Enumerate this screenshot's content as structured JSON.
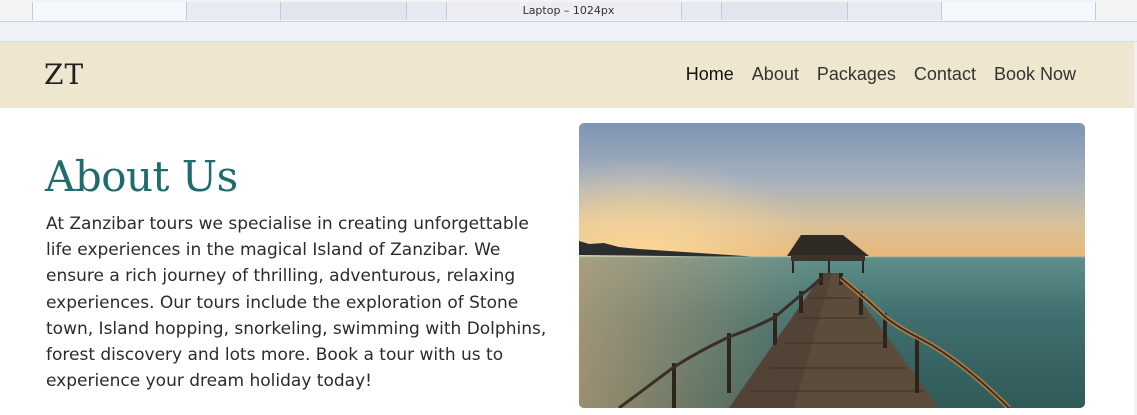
{
  "devtools": {
    "viewport_label": "Laptop – 1024px"
  },
  "header": {
    "logo": "ZT",
    "nav": [
      {
        "label": "Home",
        "active": true
      },
      {
        "label": "About",
        "active": false
      },
      {
        "label": "Packages",
        "active": false
      },
      {
        "label": "Contact",
        "active": false
      },
      {
        "label": "Book Now",
        "active": false
      }
    ]
  },
  "about": {
    "title": "About Us",
    "body": "At Zanzibar tours we specialise in creating unforgettable life experiences in the magical Island of Zanzibar. We ensure a rich journey of thrilling, adventurous, relaxing experiences. Our tours include the exploration of Stone town, Island hopping, snorkeling, swimming with Dolphins, forest discovery and lots more. Book a tour with us to experience your dream holiday today!",
    "image": "sunset-jetty-hut-photo"
  },
  "colors": {
    "header_bg": "#efe6cf",
    "title": "#1f6b6e",
    "text": "#2b2b2b"
  }
}
